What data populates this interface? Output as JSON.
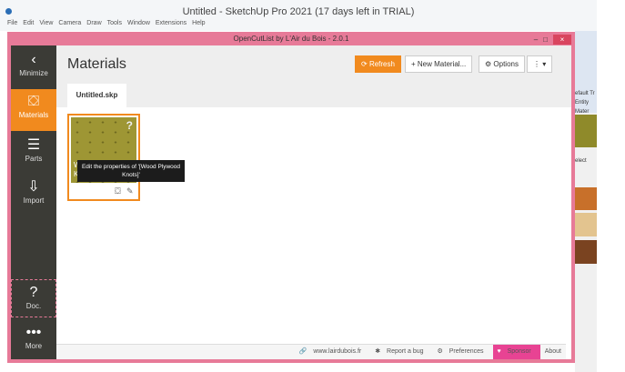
{
  "app_title": "Untitled - SketchUp Pro 2021 (17 days left in TRIAL)",
  "menu": [
    "File",
    "Edit",
    "View",
    "Camera",
    "Draw",
    "Tools",
    "Window",
    "Extensions",
    "Help"
  ],
  "plugin_title": "OpenCutList by L'Air du Bois - 2.0.1",
  "sidebar": {
    "minimize": "Minimize",
    "materials": "Materials",
    "parts": "Parts",
    "import": "Import",
    "doc": "Doc.",
    "more": "More"
  },
  "header": {
    "title": "Materials",
    "refresh": "Refresh",
    "new_material": "+ New Material...",
    "options": "Options",
    "more": "⋮ ▾"
  },
  "tab": "Untitled.skp",
  "card": {
    "badge": "?",
    "label_initials": "W K",
    "tooltip": "Edit the properties of '[Wood Plywood Knots]'"
  },
  "footer": {
    "website": "www.lairdubois.fr",
    "report": "Report a bug",
    "preferences": "Preferences",
    "sponsor": "Sponsor",
    "about": "About"
  },
  "right_panel": [
    "efault Tr",
    "Entity",
    "Mater",
    "elect"
  ],
  "colors": {
    "accent": "#f18a1e",
    "window": "#e77a98",
    "sponsor": "#e84393"
  }
}
